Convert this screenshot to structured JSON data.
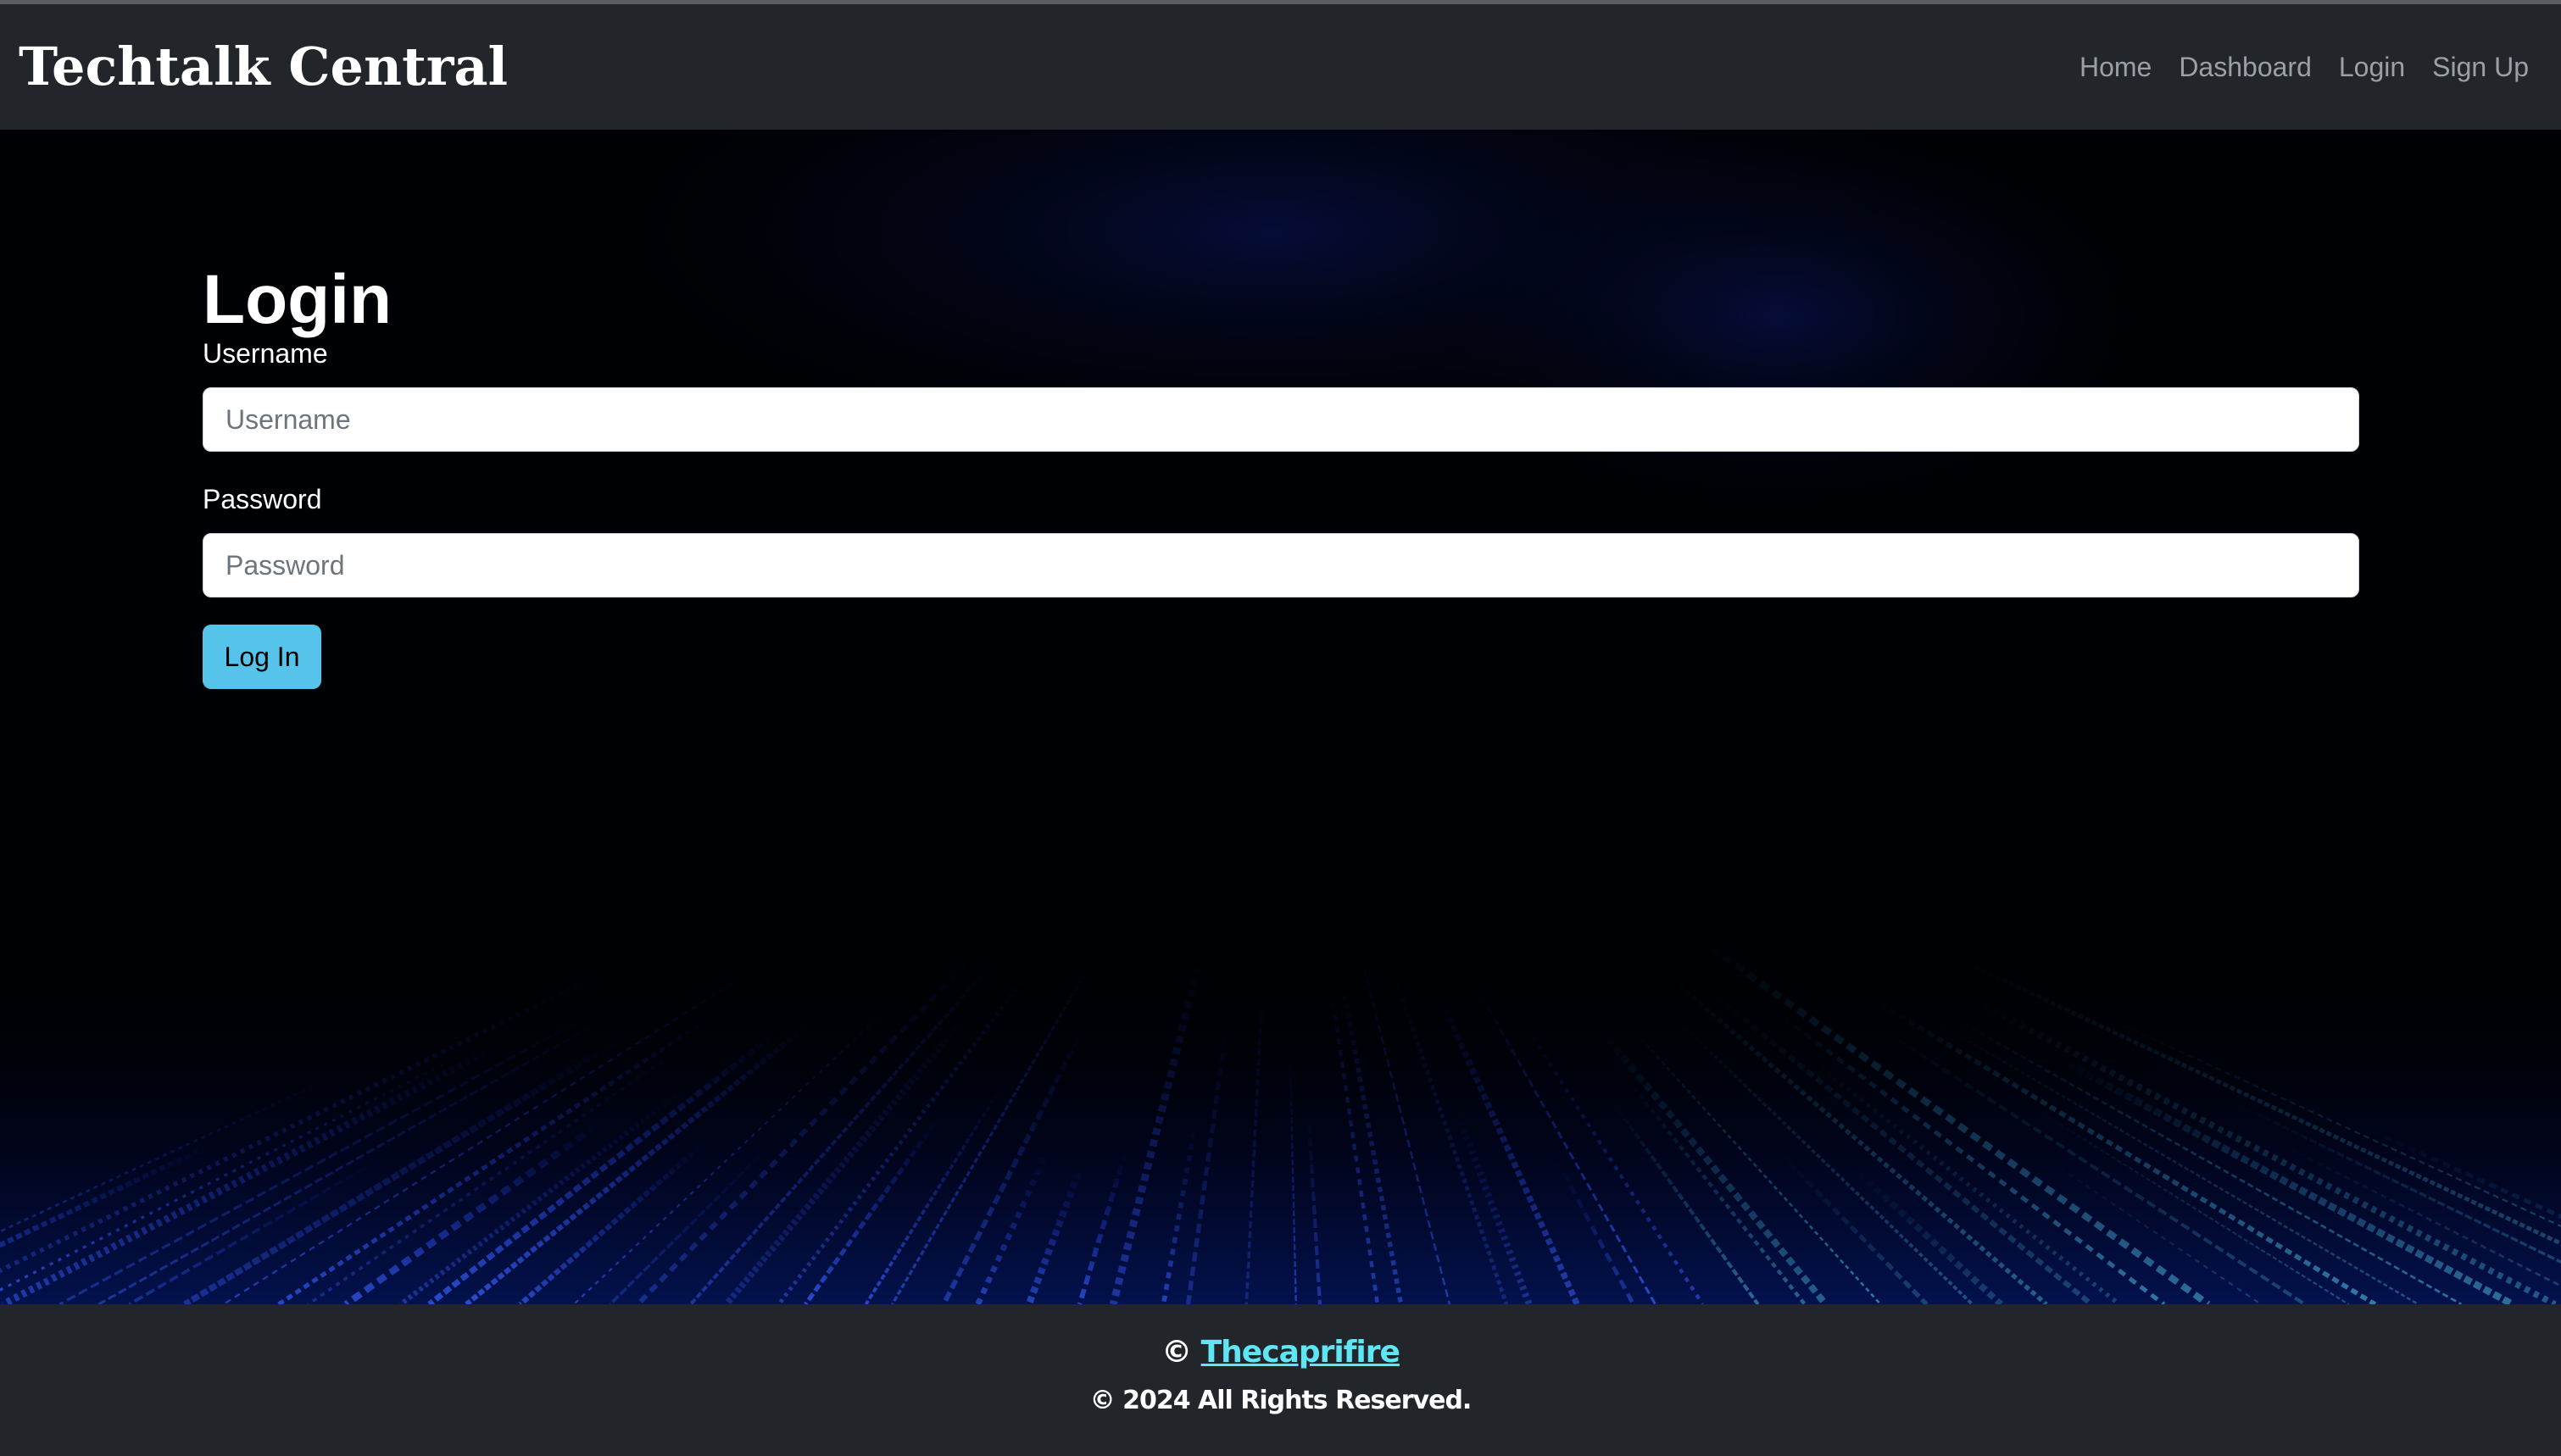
{
  "header": {
    "brand": "Techtalk Central",
    "nav_items": [
      {
        "label": "Home"
      },
      {
        "label": "Dashboard"
      },
      {
        "label": "Login"
      },
      {
        "label": "Sign Up"
      }
    ]
  },
  "main": {
    "title": "Login",
    "username": {
      "label": "Username",
      "placeholder": "Username",
      "value": ""
    },
    "password": {
      "label": "Password",
      "placeholder": "Password",
      "value": ""
    },
    "submit_label": "Log In"
  },
  "footer": {
    "copyright_symbol": "©",
    "author_link": "Thecaprifire",
    "rights": "© 2024 All Rights Reserved."
  },
  "colors": {
    "navbar_background": "#22262b",
    "button_accent": "#55c3ea",
    "footer_link": "#5fe6f5",
    "background": "#000103"
  }
}
